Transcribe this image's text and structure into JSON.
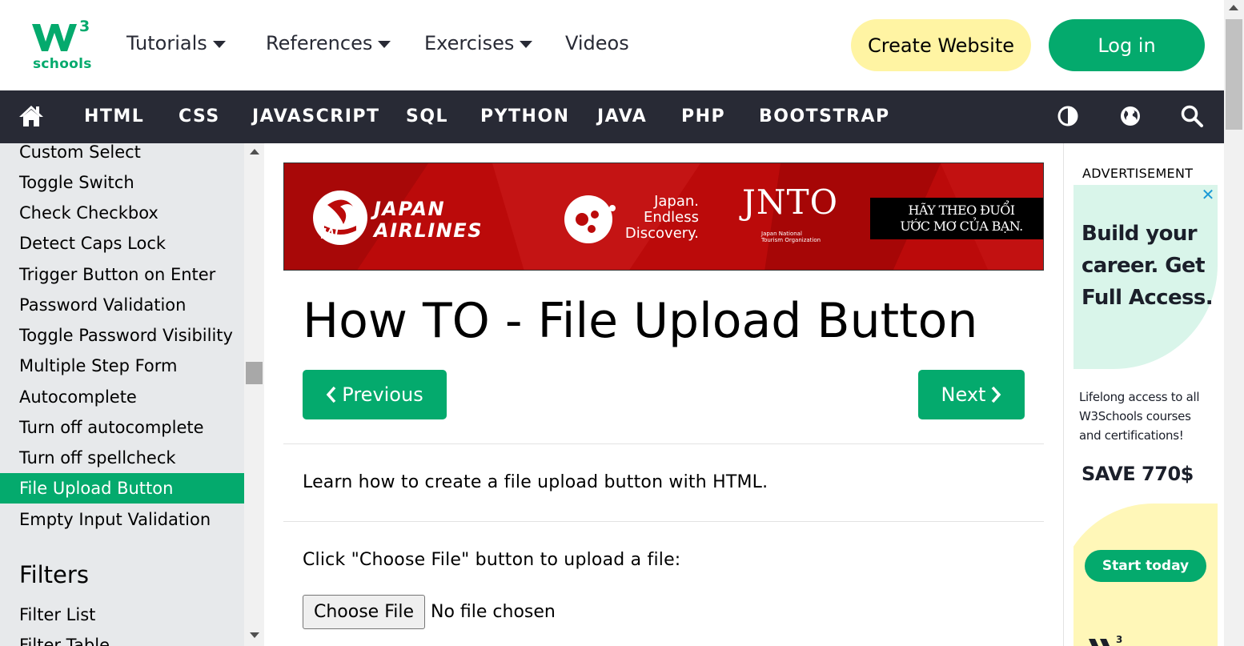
{
  "header": {
    "logo_superscript": "3",
    "logo_word": "schools",
    "nav": [
      {
        "label": "Tutorials",
        "dropdown": true
      },
      {
        "label": "References",
        "dropdown": true
      },
      {
        "label": "Exercises",
        "dropdown": true
      },
      {
        "label": "Videos",
        "dropdown": false
      }
    ],
    "create_website": "Create Website",
    "login": "Log in"
  },
  "subnav": {
    "home_icon": "home-icon",
    "links": [
      "HTML",
      "CSS",
      "JAVASCRIPT",
      "SQL",
      "PYTHON",
      "JAVA",
      "PHP",
      "BOOTSTRAP"
    ],
    "right_icons": [
      "contrast-icon",
      "globe-icon",
      "search-icon"
    ]
  },
  "sidebar": {
    "items": [
      "Custom Select",
      "Toggle Switch",
      "Check Checkbox",
      "Detect Caps Lock",
      "Trigger Button on Enter",
      "Password Validation",
      "Toggle Password Visibility",
      "Multiple Step Form",
      "Autocomplete",
      "Turn off autocomplete",
      "Turn off spellcheck",
      "File Upload Button",
      "Empty Input Validation"
    ],
    "active_item": "File Upload Button",
    "section_heading": "Filters",
    "section_items": [
      "Filter List",
      "Filter Table"
    ]
  },
  "ad_banner": {
    "brand": "JAPAN\nAIRLINES",
    "jal": "JAL",
    "tagline": "Japan.\nEndless\nDiscovery.",
    "jnto": "JNTO",
    "jnto_sub": "Japan National\nTourism Organization",
    "slogan": "HÃY THEO ĐUỔI\nƯỚC MƠ CỦA BẠN."
  },
  "main": {
    "title": "How TO - File Upload Button",
    "prev_label": "Previous",
    "next_label": "Next",
    "intro": "Learn how to create a file upload button with HTML.",
    "instruction": "Click \"Choose File\" button to upload a file:",
    "file_button": "Choose File",
    "file_status": "No file chosen"
  },
  "right_ad": {
    "label": "ADVERTISEMENT",
    "close": "✕",
    "headline": "Build your career. Get Full Access.",
    "body": "Lifelong access to all W3Schools courses and certifications!",
    "offer": "SAVE 770$",
    "cta": "Start today"
  },
  "colors": {
    "brand_green": "#04aa6d",
    "dark_nav": "#282a35",
    "create_yellow": "#fff4a3",
    "sidebar_bg": "#e7e9eb",
    "banner_red": "#bb0a0a"
  }
}
